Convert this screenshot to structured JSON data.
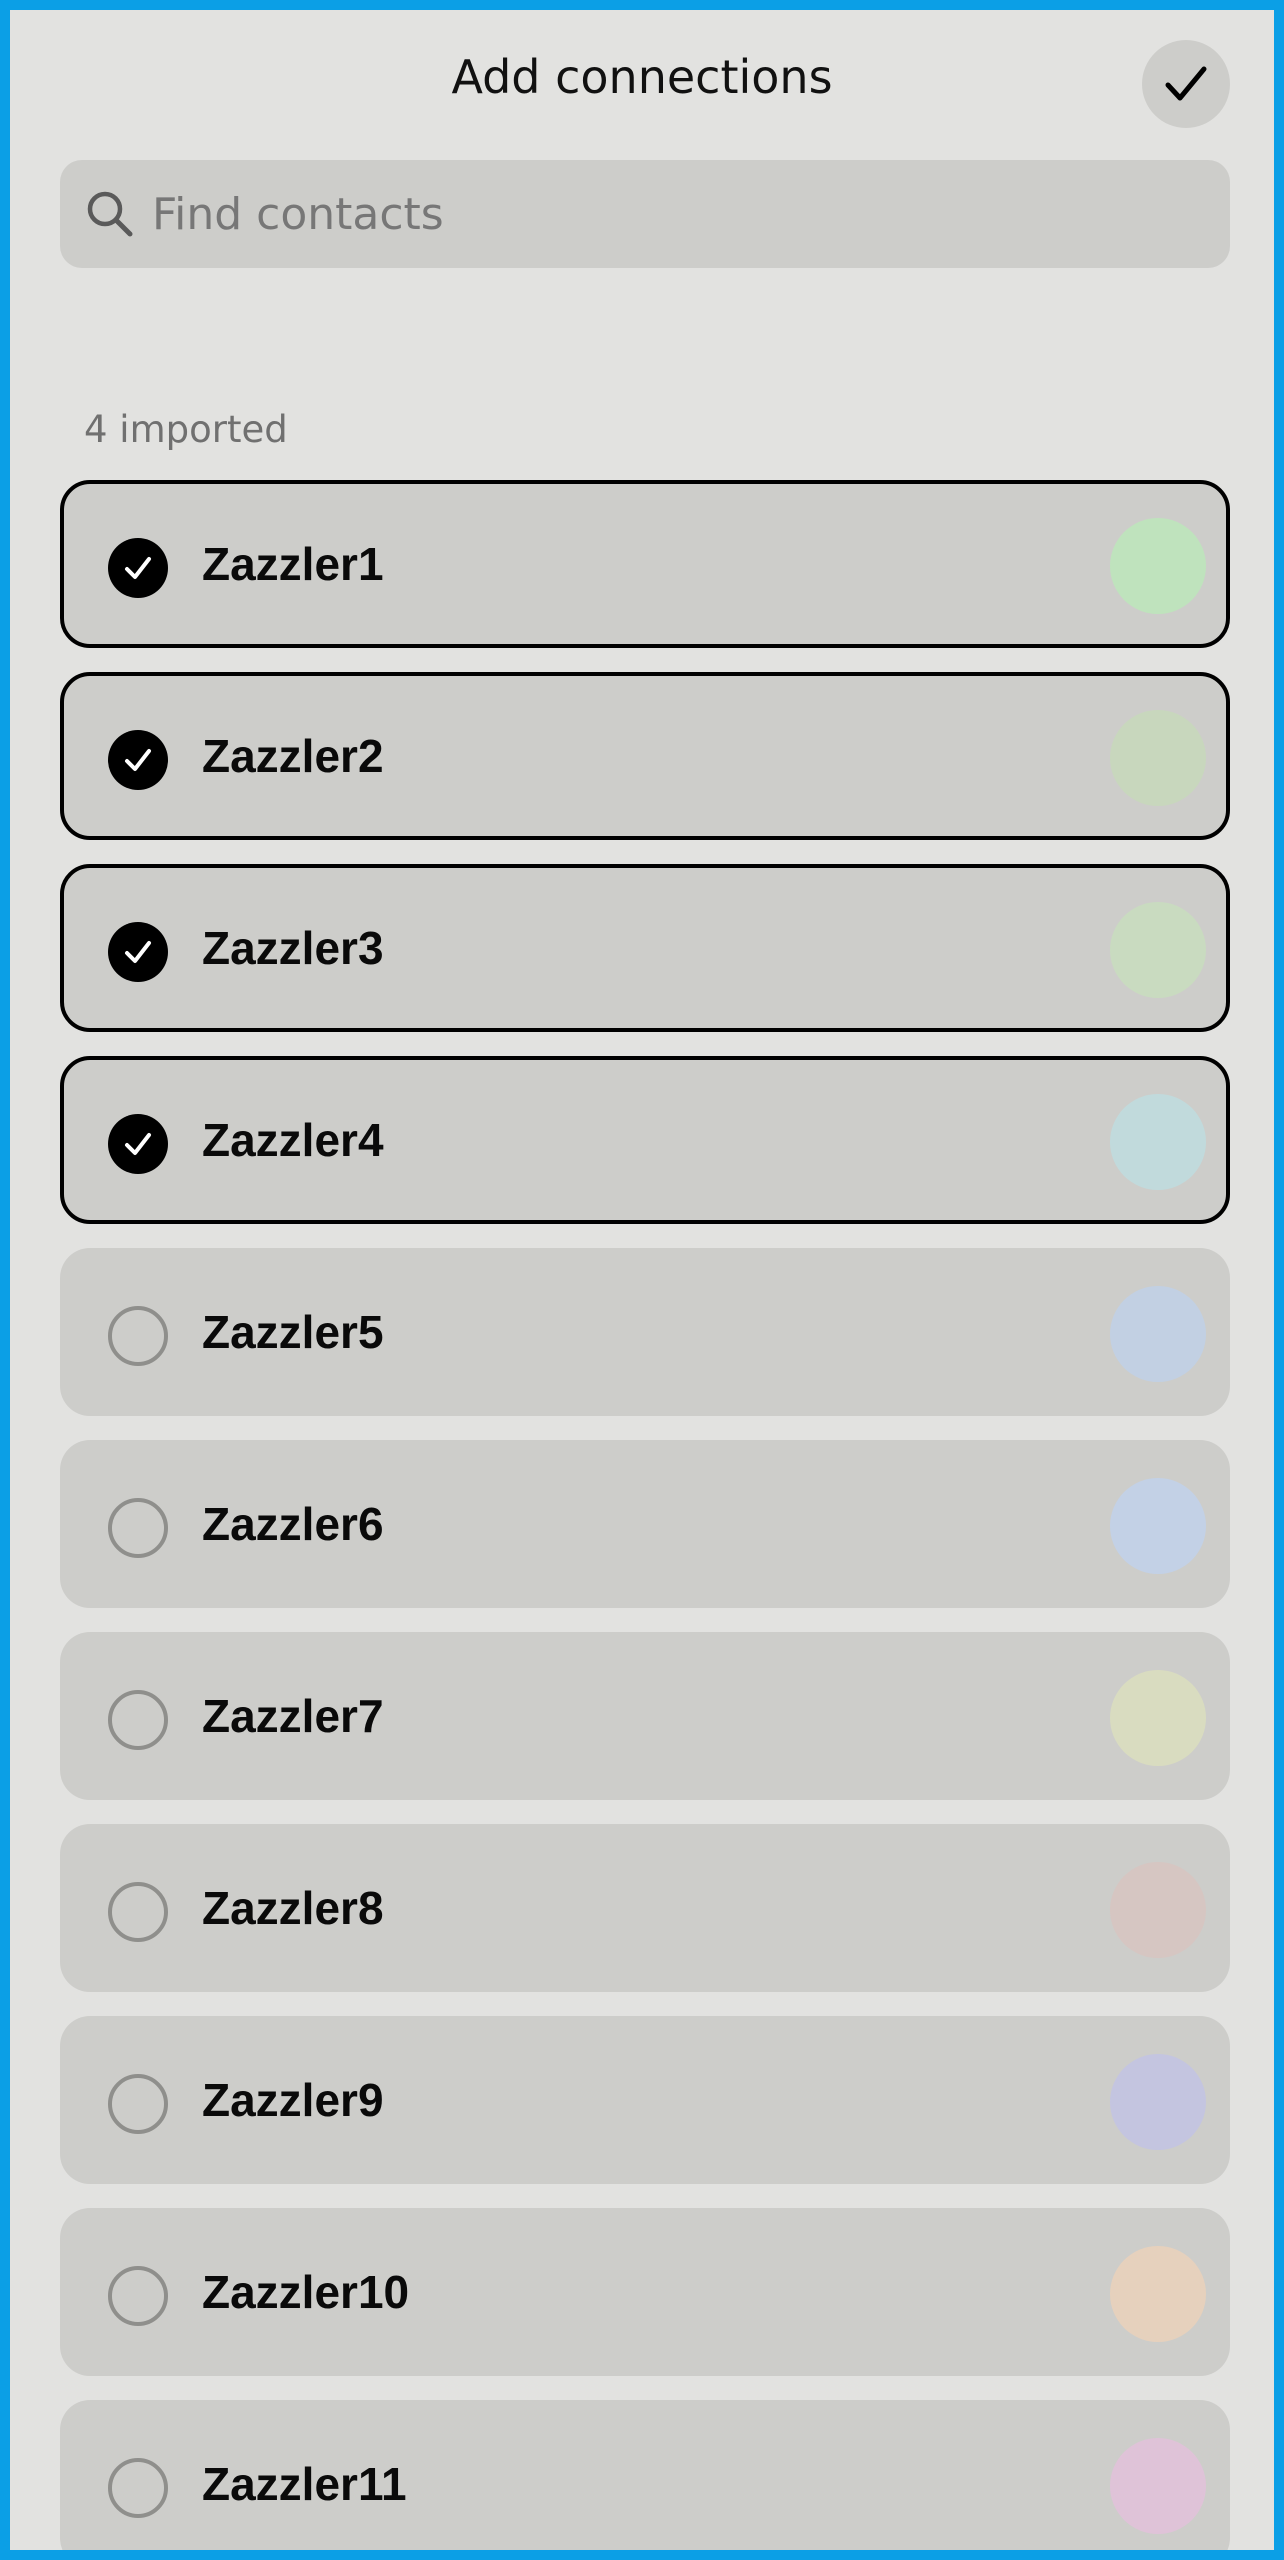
{
  "header": {
    "title": "Add connections",
    "done_icon": "checkmark-icon"
  },
  "search": {
    "placeholder": "Find contacts",
    "value": "",
    "icon": "search-icon"
  },
  "section": {
    "label": "4 imported"
  },
  "contacts": [
    {
      "name": "Zazzler1",
      "selected": true,
      "avatar_color": "#bfe3bd"
    },
    {
      "name": "Zazzler2",
      "selected": true,
      "avatar_color": "#c8d7bd"
    },
    {
      "name": "Zazzler3",
      "selected": true,
      "avatar_color": "#c9dbc0"
    },
    {
      "name": "Zazzler4",
      "selected": true,
      "avatar_color": "#c1dadc"
    },
    {
      "name": "Zazzler5",
      "selected": false,
      "avatar_color": "#c2d0e3"
    },
    {
      "name": "Zazzler6",
      "selected": false,
      "avatar_color": "#c3d1e6"
    },
    {
      "name": "Zazzler7",
      "selected": false,
      "avatar_color": "#d9dcc0"
    },
    {
      "name": "Zazzler8",
      "selected": false,
      "avatar_color": "#d6c6c2"
    },
    {
      "name": "Zazzler9",
      "selected": false,
      "avatar_color": "#c4c5e0"
    },
    {
      "name": "Zazzler10",
      "selected": false,
      "avatar_color": "#e6d1bd"
    },
    {
      "name": "Zazzler11",
      "selected": false,
      "avatar_color": "#dfc3d8"
    }
  ],
  "colors": {
    "frame": "#0b9fe6",
    "background": "#e2e2e0",
    "card": "#cdcdca",
    "selected_border": "#000000"
  }
}
